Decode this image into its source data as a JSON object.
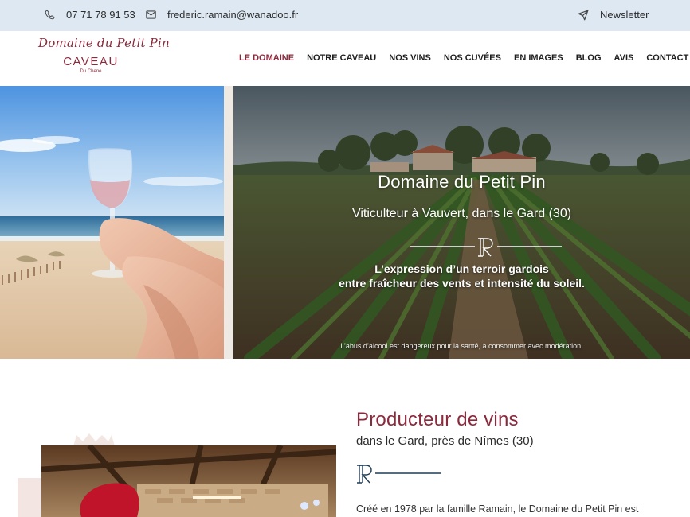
{
  "topbar": {
    "phone": "07 71 78 91 53",
    "email": "frederic.ramain@wanadoo.fr",
    "newsletter": "Newsletter"
  },
  "logo": {
    "script": "Domaine du Petit Pin",
    "main": "CAVEAU",
    "sub": "Du Chene"
  },
  "nav": {
    "items": [
      {
        "label": "LE DOMAINE"
      },
      {
        "label": "NOTRE CAVEAU"
      },
      {
        "label": "NOS VINS"
      },
      {
        "label": "NOS CUVÉES"
      },
      {
        "label": "EN IMAGES"
      },
      {
        "label": "BLOG"
      },
      {
        "label": "AVIS"
      },
      {
        "label": "CONTACT"
      }
    ]
  },
  "hero": {
    "title": "Domaine du Petit Pin",
    "subtitle": "Viticulteur à Vauvert, dans le Gard (30)",
    "tagline_1": "L’expression d’un terroir gardois",
    "tagline_2": "entre fraîcheur des vents et intensité du soleil.",
    "legal": "L’abus d’alcool est dangereux pour la santé, à consommer avec modération."
  },
  "producer": {
    "title": "Producteur de vins",
    "subtitle": "dans le Gard, près de Nîmes (30)",
    "body": "Créé en 1978 par la famille Ramain, le Domaine du Petit Pin est"
  },
  "colors": {
    "accent": "#8a2a3c",
    "topbar_bg": "#dde8f2",
    "divider_blue": "#1f3b55"
  },
  "icons": {
    "phone": "phone-icon",
    "mail": "mail-icon",
    "newsletter": "send-icon",
    "ornament": "monogram-r-icon"
  }
}
